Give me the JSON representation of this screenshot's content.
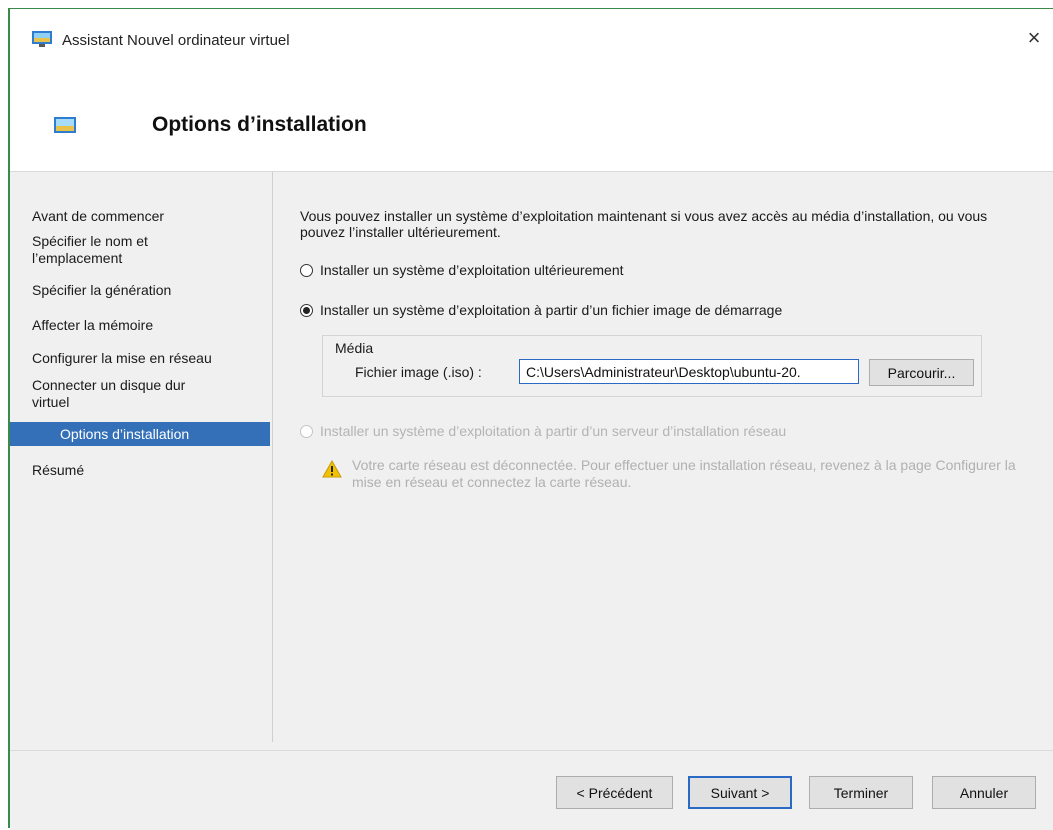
{
  "window": {
    "title": "Assistant Nouvel ordinateur virtuel",
    "close_symbol": "×",
    "icon": "vm-wizard-icon"
  },
  "header": {
    "title": "Options d’installation",
    "icon": "vm-wizard-icon"
  },
  "nav": {
    "items": [
      {
        "label": "Avant de commencer",
        "selected": false
      },
      {
        "label": "Spécifier le nom et l’emplacement",
        "selected": false
      },
      {
        "label": "Spécifier la génération",
        "selected": false
      },
      {
        "label": "Affecter la mémoire",
        "selected": false
      },
      {
        "label": "Configurer la mise en réseau",
        "selected": false
      },
      {
        "label": "Connecter un disque dur virtuel",
        "selected": false
      },
      {
        "label": "Options d’installation",
        "selected": true
      },
      {
        "label": "Résumé",
        "selected": false
      }
    ],
    "selected_color": "#3470b8"
  },
  "content": {
    "intro": "Vous pouvez installer un système d’exploitation maintenant si vous avez accès au média d’installation, ou vous pouvez l’installer ultérieurement.",
    "options": [
      {
        "label": "Installer un système d’exploitation ultérieurement",
        "checked": false,
        "enabled": true
      },
      {
        "label": "Installer un système d’exploitation à partir d’un fichier image de démarrage",
        "checked": true,
        "enabled": true
      },
      {
        "label": "Installer un système d’exploitation à partir d’un serveur d’installation réseau",
        "checked": false,
        "enabled": false
      }
    ],
    "media": {
      "legend": "Média",
      "iso_label": "Fichier image (.iso) :",
      "iso_value": "C:\\Users\\Administrateur\\Desktop\\ubuntu-20.",
      "browse_label": "Parcourir..."
    },
    "warning": "Votre carte réseau est déconnectée. Pour effectuer une installation réseau, revenez à la page Configurer la mise en réseau et connectez la carte réseau."
  },
  "footer": {
    "previous": "< Précédent",
    "next": "Suivant >",
    "finish": "Terminer",
    "cancel": "Annuler"
  },
  "colors": {
    "accent": "#2a6ac5",
    "window_border": "#3c8a4a",
    "warning": "#f2c200"
  }
}
